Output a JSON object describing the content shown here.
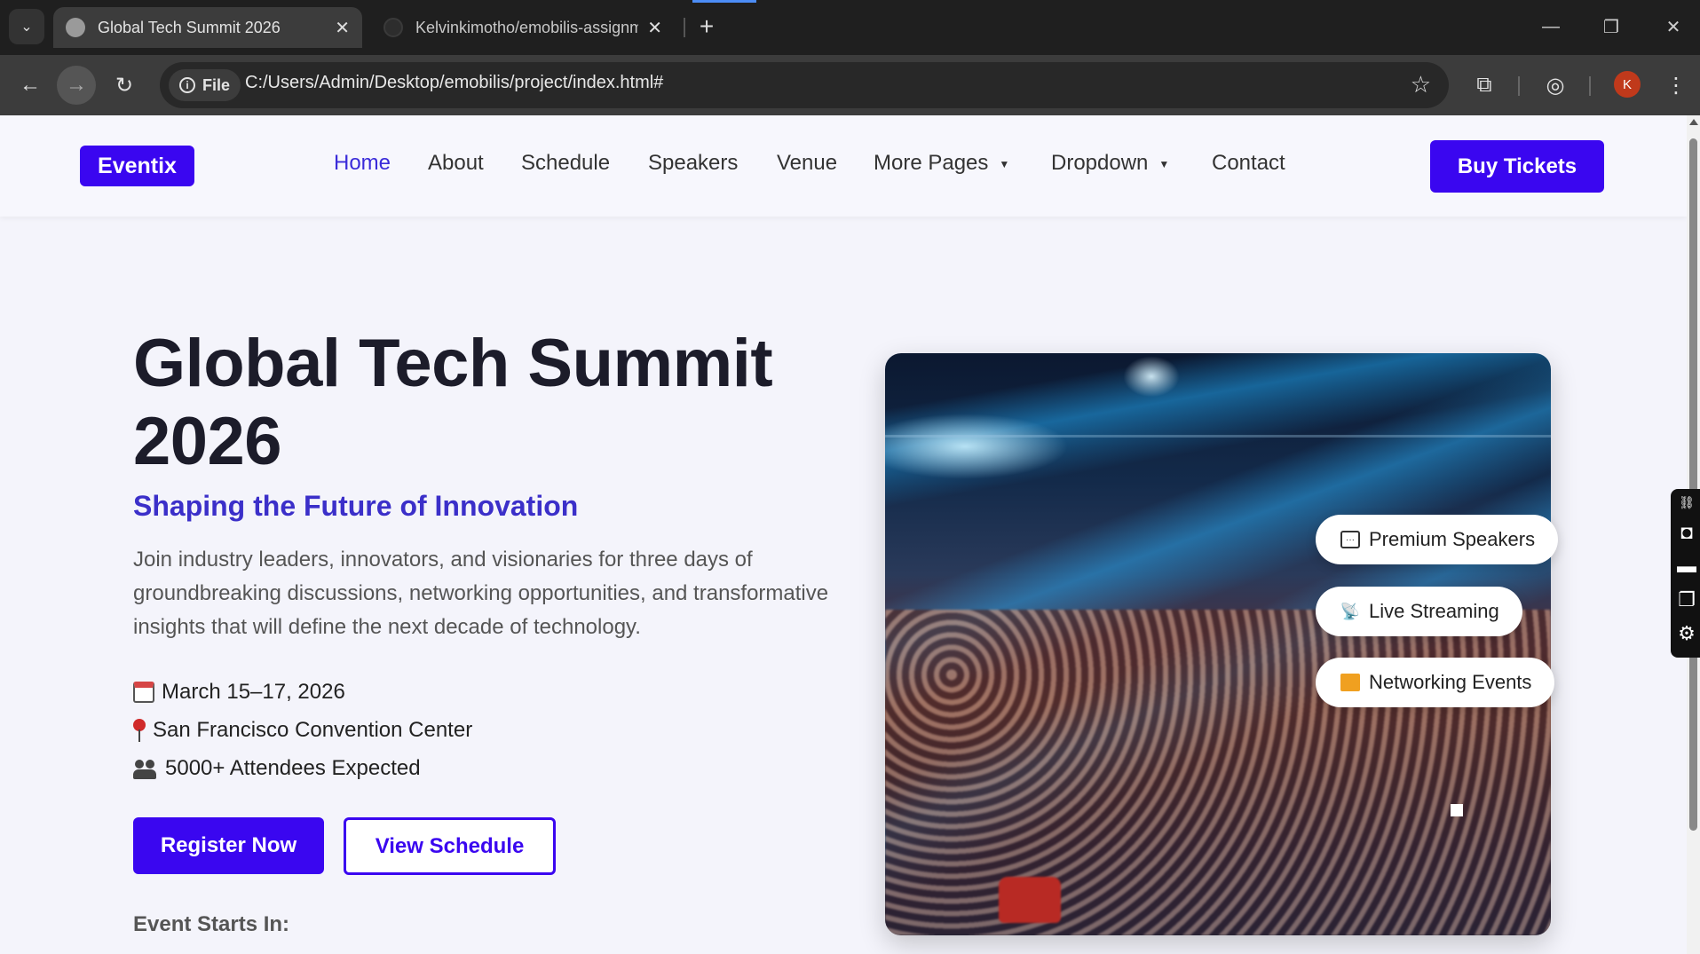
{
  "browser": {
    "tabs": [
      {
        "title": "Global Tech Summit 2026",
        "active": true
      },
      {
        "title": "Kelvinkimotho/emobilis-assignm",
        "active": false
      }
    ],
    "address": {
      "chip_label": "File",
      "url": "C:/Users/Admin/Desktop/emobilis/project/index.html#"
    },
    "profile_initial": "K",
    "icons": {
      "tab_menu": "chevron-down-icon",
      "new_tab": "plus-icon",
      "minimize": "minimize-icon",
      "restore": "restore-icon",
      "close": "close-icon",
      "back": "back-arrow-icon",
      "forward": "forward-arrow-icon",
      "reload": "reload-icon",
      "bookmark": "star-icon",
      "extensions": "puzzle-icon",
      "screenshot": "camera-lens-icon",
      "menu": "kebab-menu-icon"
    }
  },
  "site": {
    "logo": "Eventix",
    "nav": [
      {
        "label": "Home",
        "active": true
      },
      {
        "label": "About"
      },
      {
        "label": "Schedule"
      },
      {
        "label": "Speakers"
      },
      {
        "label": "Venue"
      },
      {
        "label": "More Pages",
        "dropdown": true
      },
      {
        "label": "Dropdown",
        "dropdown": true
      },
      {
        "label": "Contact"
      }
    ],
    "cta": "Buy Tickets",
    "colors": {
      "primary": "#3a06f0",
      "accent_text": "#3b2fc9",
      "background": "#f4f4fb"
    }
  },
  "hero": {
    "title": "Global Tech Summit 2026",
    "subtitle": "Shaping the Future of Innovation",
    "description": "Join industry leaders, innovators, and visionaries for three days of groundbreaking discussions, networking opportunities, and transformative insights that will define the next decade of technology.",
    "details": [
      {
        "icon": "calendar-icon",
        "text": "March 15–17, 2026"
      },
      {
        "icon": "pin-icon",
        "text": "San Francisco Convention Center"
      },
      {
        "icon": "people-icon",
        "text": "5000+ Attendees Expected"
      }
    ],
    "primary_button": "Register Now",
    "secondary_button": "View Schedule",
    "countdown_label": "Event Starts In:",
    "features": [
      {
        "icon": "chat-icon",
        "text": "Premium Speakers"
      },
      {
        "icon": "satellite-icon",
        "text": "Live Streaming"
      },
      {
        "icon": "gift-icon",
        "text": "Networking Events"
      }
    ]
  },
  "side_tools": [
    "link-icon",
    "camera-icon",
    "video-icon",
    "window-icon",
    "gear-icon"
  ]
}
